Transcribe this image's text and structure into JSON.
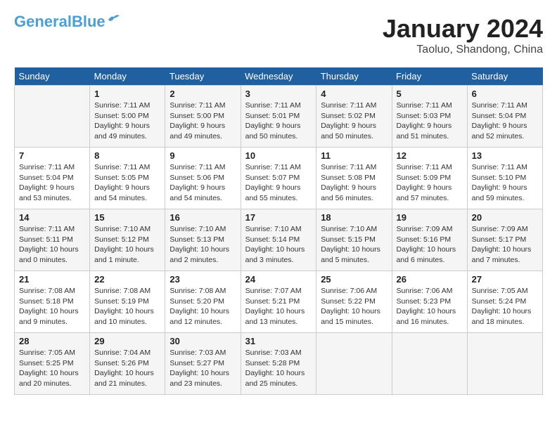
{
  "header": {
    "logo_general": "General",
    "logo_blue": "Blue",
    "month_title": "January 2024",
    "location": "Taoluo, Shandong, China"
  },
  "days_of_week": [
    "Sunday",
    "Monday",
    "Tuesday",
    "Wednesday",
    "Thursday",
    "Friday",
    "Saturday"
  ],
  "weeks": [
    [
      {
        "day": "",
        "info": ""
      },
      {
        "day": "1",
        "info": "Sunrise: 7:11 AM\nSunset: 5:00 PM\nDaylight: 9 hours\nand 49 minutes."
      },
      {
        "day": "2",
        "info": "Sunrise: 7:11 AM\nSunset: 5:00 PM\nDaylight: 9 hours\nand 49 minutes."
      },
      {
        "day": "3",
        "info": "Sunrise: 7:11 AM\nSunset: 5:01 PM\nDaylight: 9 hours\nand 50 minutes."
      },
      {
        "day": "4",
        "info": "Sunrise: 7:11 AM\nSunset: 5:02 PM\nDaylight: 9 hours\nand 50 minutes."
      },
      {
        "day": "5",
        "info": "Sunrise: 7:11 AM\nSunset: 5:03 PM\nDaylight: 9 hours\nand 51 minutes."
      },
      {
        "day": "6",
        "info": "Sunrise: 7:11 AM\nSunset: 5:04 PM\nDaylight: 9 hours\nand 52 minutes."
      }
    ],
    [
      {
        "day": "7",
        "info": "Sunrise: 7:11 AM\nSunset: 5:04 PM\nDaylight: 9 hours\nand 53 minutes."
      },
      {
        "day": "8",
        "info": "Sunrise: 7:11 AM\nSunset: 5:05 PM\nDaylight: 9 hours\nand 54 minutes."
      },
      {
        "day": "9",
        "info": "Sunrise: 7:11 AM\nSunset: 5:06 PM\nDaylight: 9 hours\nand 54 minutes."
      },
      {
        "day": "10",
        "info": "Sunrise: 7:11 AM\nSunset: 5:07 PM\nDaylight: 9 hours\nand 55 minutes."
      },
      {
        "day": "11",
        "info": "Sunrise: 7:11 AM\nSunset: 5:08 PM\nDaylight: 9 hours\nand 56 minutes."
      },
      {
        "day": "12",
        "info": "Sunrise: 7:11 AM\nSunset: 5:09 PM\nDaylight: 9 hours\nand 57 minutes."
      },
      {
        "day": "13",
        "info": "Sunrise: 7:11 AM\nSunset: 5:10 PM\nDaylight: 9 hours\nand 59 minutes."
      }
    ],
    [
      {
        "day": "14",
        "info": "Sunrise: 7:11 AM\nSunset: 5:11 PM\nDaylight: 10 hours\nand 0 minutes."
      },
      {
        "day": "15",
        "info": "Sunrise: 7:10 AM\nSunset: 5:12 PM\nDaylight: 10 hours\nand 1 minute."
      },
      {
        "day": "16",
        "info": "Sunrise: 7:10 AM\nSunset: 5:13 PM\nDaylight: 10 hours\nand 2 minutes."
      },
      {
        "day": "17",
        "info": "Sunrise: 7:10 AM\nSunset: 5:14 PM\nDaylight: 10 hours\nand 3 minutes."
      },
      {
        "day": "18",
        "info": "Sunrise: 7:10 AM\nSunset: 5:15 PM\nDaylight: 10 hours\nand 5 minutes."
      },
      {
        "day": "19",
        "info": "Sunrise: 7:09 AM\nSunset: 5:16 PM\nDaylight: 10 hours\nand 6 minutes."
      },
      {
        "day": "20",
        "info": "Sunrise: 7:09 AM\nSunset: 5:17 PM\nDaylight: 10 hours\nand 7 minutes."
      }
    ],
    [
      {
        "day": "21",
        "info": "Sunrise: 7:08 AM\nSunset: 5:18 PM\nDaylight: 10 hours\nand 9 minutes."
      },
      {
        "day": "22",
        "info": "Sunrise: 7:08 AM\nSunset: 5:19 PM\nDaylight: 10 hours\nand 10 minutes."
      },
      {
        "day": "23",
        "info": "Sunrise: 7:08 AM\nSunset: 5:20 PM\nDaylight: 10 hours\nand 12 minutes."
      },
      {
        "day": "24",
        "info": "Sunrise: 7:07 AM\nSunset: 5:21 PM\nDaylight: 10 hours\nand 13 minutes."
      },
      {
        "day": "25",
        "info": "Sunrise: 7:06 AM\nSunset: 5:22 PM\nDaylight: 10 hours\nand 15 minutes."
      },
      {
        "day": "26",
        "info": "Sunrise: 7:06 AM\nSunset: 5:23 PM\nDaylight: 10 hours\nand 16 minutes."
      },
      {
        "day": "27",
        "info": "Sunrise: 7:05 AM\nSunset: 5:24 PM\nDaylight: 10 hours\nand 18 minutes."
      }
    ],
    [
      {
        "day": "28",
        "info": "Sunrise: 7:05 AM\nSunset: 5:25 PM\nDaylight: 10 hours\nand 20 minutes."
      },
      {
        "day": "29",
        "info": "Sunrise: 7:04 AM\nSunset: 5:26 PM\nDaylight: 10 hours\nand 21 minutes."
      },
      {
        "day": "30",
        "info": "Sunrise: 7:03 AM\nSunset: 5:27 PM\nDaylight: 10 hours\nand 23 minutes."
      },
      {
        "day": "31",
        "info": "Sunrise: 7:03 AM\nSunset: 5:28 PM\nDaylight: 10 hours\nand 25 minutes."
      },
      {
        "day": "",
        "info": ""
      },
      {
        "day": "",
        "info": ""
      },
      {
        "day": "",
        "info": ""
      }
    ]
  ]
}
